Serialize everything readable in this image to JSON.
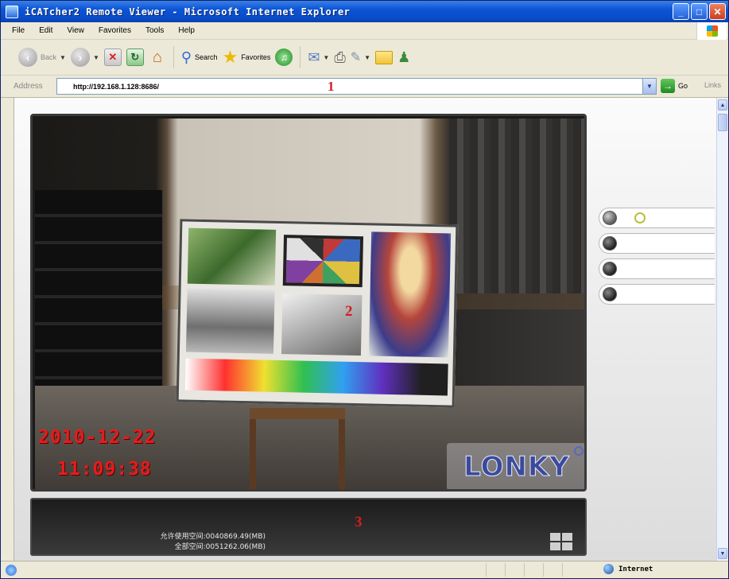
{
  "window": {
    "title": "iCATcher2 Remote Viewer - Microsoft Internet Explorer",
    "controls": [
      "_",
      "□",
      "✕"
    ]
  },
  "menu": {
    "items": [
      "File",
      "Edit",
      "View",
      "Favorites",
      "Tools",
      "Help"
    ]
  },
  "toolbar": {
    "back_label": "Back",
    "search_label": "Search",
    "favorites_label": "Favorites"
  },
  "address": {
    "label": "Address",
    "url": "http://192.168.1.128:8686/",
    "marker": "1",
    "go_label": "Go",
    "links_label": "Links"
  },
  "video": {
    "date": "2010-12-22",
    "time": "11:09:38",
    "marker": "2",
    "watermark": "LONKY"
  },
  "status_panel": {
    "marker": "3",
    "allowed_space": "允许使用空间:0040869.49(MB)",
    "total_space": "全部空间:0051262.06(MB)"
  },
  "channels": [
    {
      "id": 1,
      "active": true
    },
    {
      "id": 2,
      "active": false
    },
    {
      "id": 3,
      "active": false
    },
    {
      "id": 4,
      "active": false
    }
  ],
  "statusbar": {
    "zone": "Internet"
  },
  "colors": {
    "title_bar": "#0b55d6",
    "annotation_red": "#d41e1e",
    "osd_red": "#e51c1c",
    "panel_dark": "#2a2a2a"
  }
}
